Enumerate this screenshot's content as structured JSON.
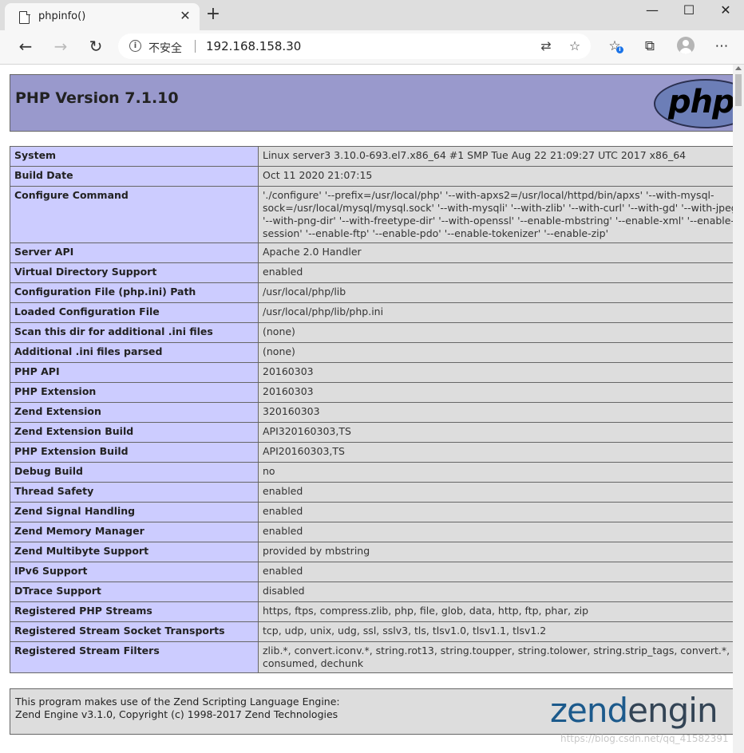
{
  "browser": {
    "tab_title": "phpinfo()",
    "insecure_label": "不安全",
    "url": "192.168.158.30"
  },
  "header": {
    "title": "PHP Version 7.1.10",
    "logo_text": "php"
  },
  "rows": [
    {
      "k": "System",
      "v": "Linux server3 3.10.0-693.el7.x86_64 #1 SMP Tue Aug 22 21:09:27 UTC 2017 x86_64"
    },
    {
      "k": "Build Date",
      "v": "Oct 11 2020 21:07:15"
    },
    {
      "k": "Configure Command",
      "v": "'./configure' '--prefix=/usr/local/php' '--with-apxs2=/usr/local/httpd/bin/apxs' '--with-mysql-sock=/usr/local/mysql/mysql.sock' '--with-mysqli' '--with-zlib' '--with-curl' '--with-gd' '--with-jpeg-dir' '--with-png-dir' '--with-freetype-dir' '--with-openssl' '--enable-mbstring' '--enable-xml' '--enable-session' '--enable-ftp' '--enable-pdo' '--enable-tokenizer' '--enable-zip'"
    },
    {
      "k": "Server API",
      "v": "Apache 2.0 Handler"
    },
    {
      "k": "Virtual Directory Support",
      "v": "enabled"
    },
    {
      "k": "Configuration File (php.ini) Path",
      "v": "/usr/local/php/lib"
    },
    {
      "k": "Loaded Configuration File",
      "v": "/usr/local/php/lib/php.ini"
    },
    {
      "k": "Scan this dir for additional .ini files",
      "v": "(none)"
    },
    {
      "k": "Additional .ini files parsed",
      "v": "(none)"
    },
    {
      "k": "PHP API",
      "v": "20160303"
    },
    {
      "k": "PHP Extension",
      "v": "20160303"
    },
    {
      "k": "Zend Extension",
      "v": "320160303"
    },
    {
      "k": "Zend Extension Build",
      "v": "API320160303,TS"
    },
    {
      "k": "PHP Extension Build",
      "v": "API20160303,TS"
    },
    {
      "k": "Debug Build",
      "v": "no"
    },
    {
      "k": "Thread Safety",
      "v": "enabled"
    },
    {
      "k": "Zend Signal Handling",
      "v": "enabled"
    },
    {
      "k": "Zend Memory Manager",
      "v": "enabled"
    },
    {
      "k": "Zend Multibyte Support",
      "v": "provided by mbstring"
    },
    {
      "k": "IPv6 Support",
      "v": "enabled"
    },
    {
      "k": "DTrace Support",
      "v": "disabled"
    },
    {
      "k": "Registered PHP Streams",
      "v": "https, ftps, compress.zlib, php, file, glob, data, http, ftp, phar, zip"
    },
    {
      "k": "Registered Stream Socket Transports",
      "v": "tcp, udp, unix, udg, ssl, sslv3, tls, tlsv1.0, tlsv1.1, tlsv1.2"
    },
    {
      "k": "Registered Stream Filters",
      "v": "zlib.*, convert.iconv.*, string.rot13, string.toupper, string.tolower, string.strip_tags, convert.*, consumed, dechunk"
    }
  ],
  "footer": {
    "line1": "This program makes use of the Zend Scripting Language Engine:",
    "line2": "Zend Engine v3.1.0, Copyright (c) 1998-2017 Zend Technologies",
    "logo_text_a": "zend",
    "logo_text_b": "engin"
  },
  "watermark": "https://blog.csdn.net/qq_41582391"
}
